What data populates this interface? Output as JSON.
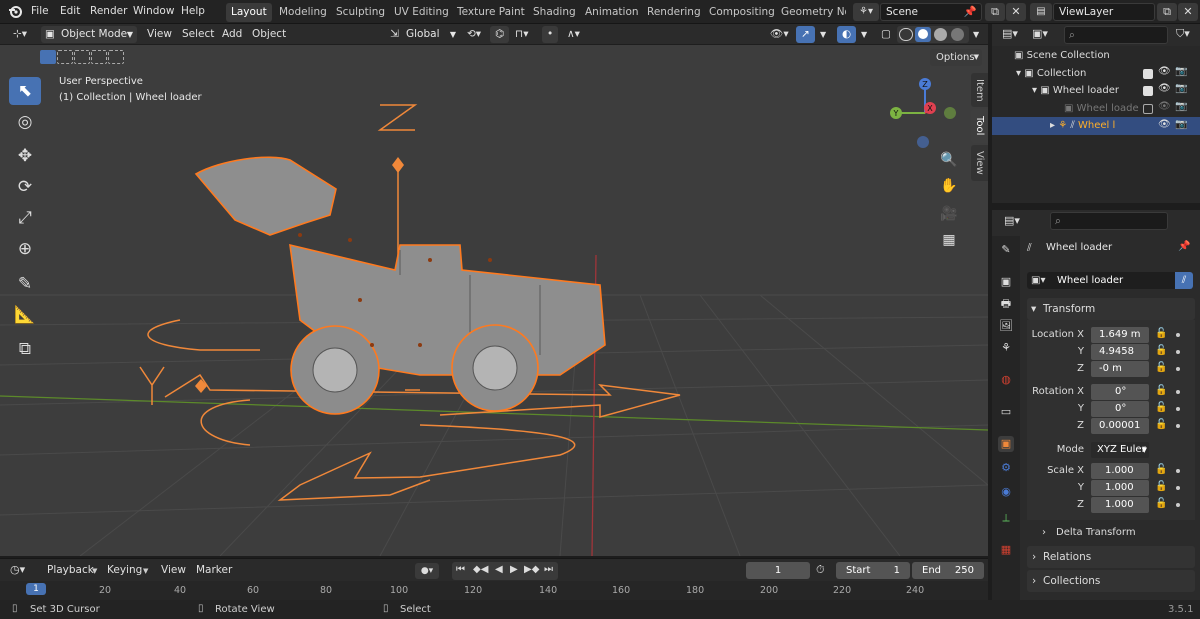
{
  "menu": [
    "File",
    "Edit",
    "Render",
    "Window",
    "Help"
  ],
  "workspaces": [
    "Layout",
    "Modeling",
    "Sculpting",
    "UV Editing",
    "Texture Paint",
    "Shading",
    "Animation",
    "Rendering",
    "Compositing",
    "Geometry Noc"
  ],
  "scene": {
    "label": "Scene"
  },
  "viewlayer": {
    "label": "ViewLayer"
  },
  "viewport_header": {
    "mode": "Object Mode",
    "menus": [
      "View",
      "Select",
      "Add",
      "Object"
    ],
    "orientation": "Global",
    "options": "Options"
  },
  "viewport": {
    "info_line1": "User Perspective",
    "info_line2": "(1) Collection | Wheel loader",
    "axis_label_z": "Z",
    "axis_label_y": "Y",
    "side_tabs": [
      "Item",
      "Tool",
      "View"
    ],
    "gizmo": {
      "x": "X",
      "y": "Y",
      "z": "Z"
    }
  },
  "outliner": {
    "rows": [
      {
        "label": "Scene Collection"
      },
      {
        "label": "Collection"
      },
      {
        "label": "Wheel loader"
      },
      {
        "label": "Wheel loade"
      },
      {
        "label": "Wheel l"
      }
    ]
  },
  "properties": {
    "object_name": "Wheel loader",
    "datablock_name": "Wheel loader",
    "transform_title": "Transform",
    "location": {
      "label_x": "Location X",
      "label_y": "Y",
      "label_z": "Z",
      "x": "1.649 m",
      "y": "4.9458",
      "z": "-0 m"
    },
    "rotation": {
      "label_x": "Rotation X",
      "label_y": "Y",
      "label_z": "Z",
      "x": "0°",
      "y": "0°",
      "z": "0.00001"
    },
    "mode": {
      "label": "Mode",
      "value": "XYZ Euler"
    },
    "scale": {
      "label_x": "Scale X",
      "label_y": "Y",
      "label_z": "Z",
      "x": "1.000",
      "y": "1.000",
      "z": "1.000"
    },
    "delta_transform": "Delta Transform",
    "relations": "Relations",
    "collections": "Collections"
  },
  "timeline": {
    "menus": [
      "Playback",
      "Keying",
      "View",
      "Marker"
    ],
    "current_frame": "1",
    "start_label": "Start",
    "start": "1",
    "end_label": "End",
    "end": "250",
    "ticks": [
      "1",
      "20",
      "40",
      "60",
      "80",
      "100",
      "120",
      "140",
      "160",
      "180",
      "200",
      "220",
      "240"
    ]
  },
  "status": {
    "items": [
      "Set 3D Cursor",
      "Rotate View",
      "Select"
    ],
    "version": "3.5.1"
  },
  "colors": {
    "accent": "#4772b3",
    "selection": "#f0883a",
    "active_highlight": "#ffaf29"
  }
}
